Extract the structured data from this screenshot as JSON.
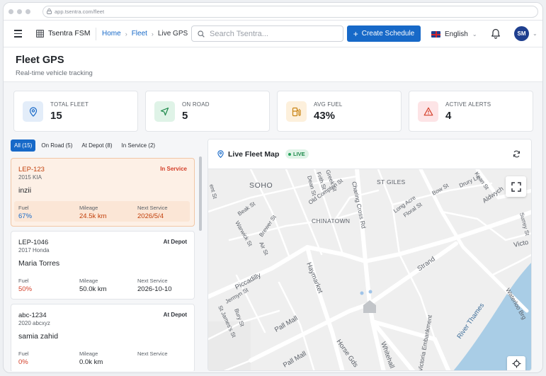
{
  "browser": {
    "url": "app.tsentra.com/fleet"
  },
  "header": {
    "brand": "Tsentra FSM",
    "breadcrumb": [
      "Home",
      "Fleet",
      "Live GPS"
    ],
    "search_placeholder": "Search Tsentra...",
    "create_button": "Create Schedule",
    "language": "English",
    "avatar_initials": "SM"
  },
  "page": {
    "title": "Fleet GPS",
    "subtitle": "Real-time vehicle tracking"
  },
  "stats": [
    {
      "label": "TOTAL FLEET",
      "value": "15",
      "icon": "location-pin-icon",
      "color": "#e3edf9"
    },
    {
      "label": "ON ROAD",
      "value": "5",
      "icon": "navigation-arrow-icon",
      "color": "#dff3e7"
    },
    {
      "label": "AVG FUEL",
      "value": "43%",
      "icon": "fuel-pump-icon",
      "color": "#fdf0dc"
    },
    {
      "label": "ACTIVE ALERTS",
      "value": "4",
      "icon": "warning-triangle-icon",
      "color": "#fde4e6"
    }
  ],
  "filters": [
    "All (15)",
    "On Road (5)",
    "At Depot (8)",
    "In Service (2)"
  ],
  "vehicles": [
    {
      "plate": "LEP-123",
      "model": "2015 KIA",
      "status": "In Service",
      "driver": "inzii",
      "fuel_label": "Fuel",
      "fuel": "67%",
      "mileage_label": "Mileage",
      "mileage": "24.5k km",
      "next_label": "Next Service",
      "next": "2026/5/4"
    },
    {
      "plate": "LEP-1046",
      "model": "2017 Honda",
      "status": "At Depot",
      "driver": "Maria Torres",
      "fuel_label": "Fuel",
      "fuel": "50%",
      "mileage_label": "Mileage",
      "mileage": "50.0k km",
      "next_label": "Next Service",
      "next": "2026-10-10"
    },
    {
      "plate": "abc-1234",
      "model": "2020 abcxyz",
      "status": "At Depot",
      "driver": "samia zahid",
      "fuel_label": "Fuel",
      "fuel": "0%",
      "mileage_label": "Mileage",
      "mileage": "0.0k km",
      "next_label": "Next Service",
      "next": ""
    }
  ],
  "map": {
    "title": "Live Fleet Map",
    "badge": "LIVE",
    "labels": {
      "soho": "SOHO",
      "st_giles": "ST GILES",
      "chinatown": "CHINATOWN",
      "charing_cross_rd": "Charing Cross Rd",
      "old_compton": "Old Compton St",
      "frith": "Frith St",
      "dean": "Dean St",
      "greek": "Greek St",
      "beak": "Beak St",
      "warwick": "Warwick St",
      "brewer": "Brewer St",
      "air": "Air St",
      "piccadilly": "Piccadilly",
      "haymarket": "Haymarket",
      "jermyn": "Jermyn St",
      "bury": "Bury St",
      "st_james": "St James's St",
      "pall_mall": "Pall Mall",
      "pall_mall2": "Pall Mall",
      "horse_gds": "Horse Gds",
      "whitehall": "Whitehall",
      "embankment": "Victoria Embankment",
      "river": "River Thames",
      "strand": "Strand",
      "waterloo": "Waterloo Brg",
      "long_acre": "Long Acre",
      "floral": "Floral St",
      "bow": "Bow St",
      "drury": "Drury Ln",
      "kean": "Kean St",
      "aldwych": "Aldwych",
      "surrey": "Surrey St",
      "victoria": "Victo",
      "ent_st": "ent St"
    }
  }
}
